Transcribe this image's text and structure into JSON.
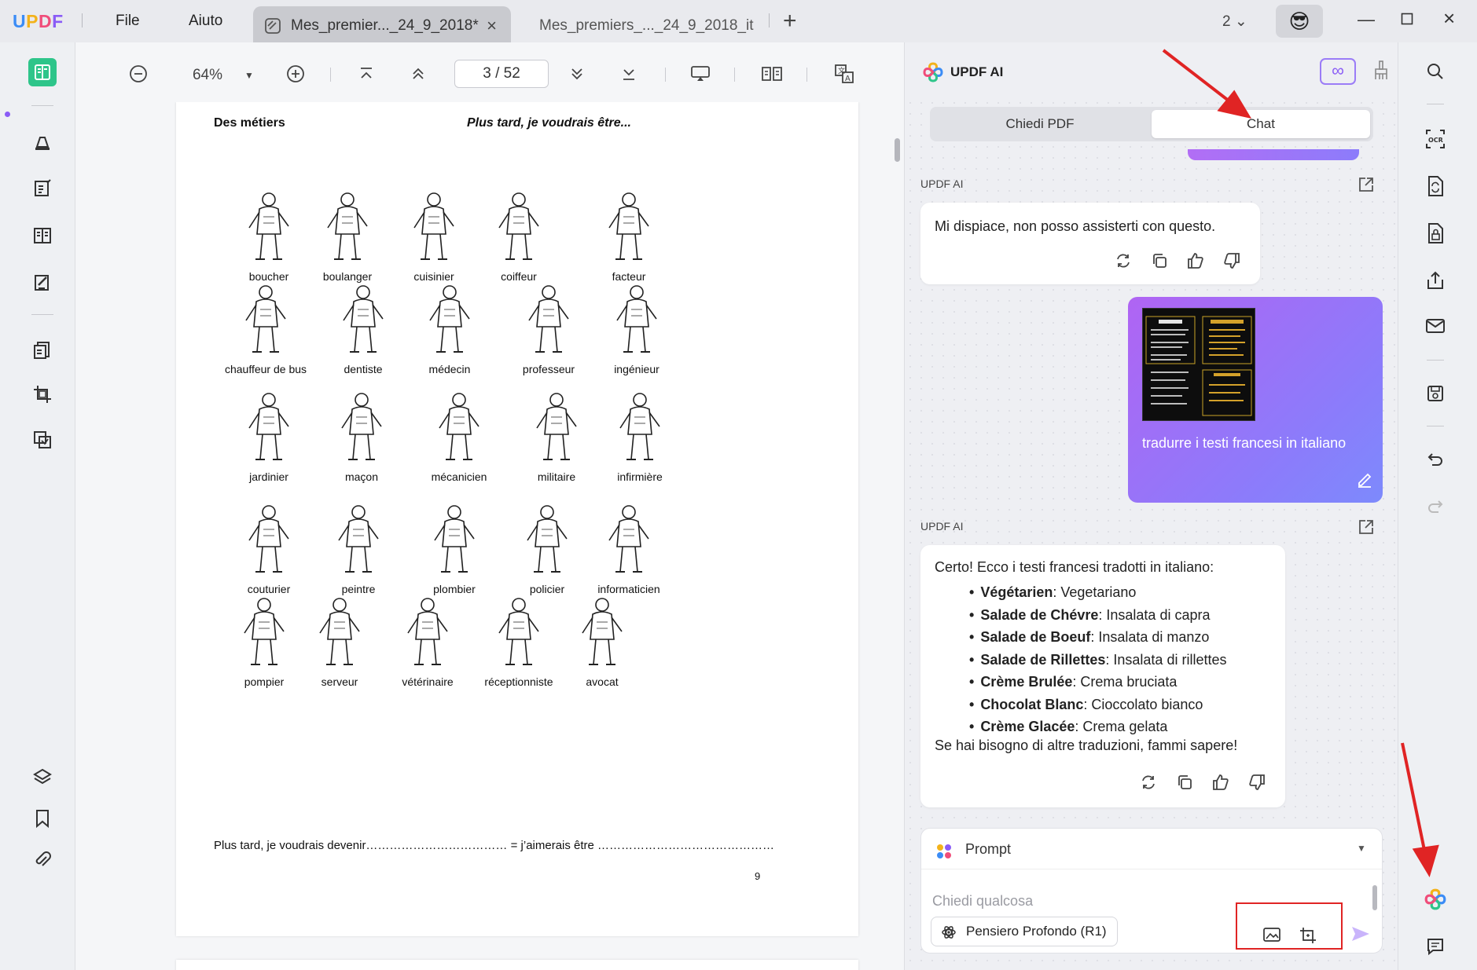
{
  "app": {
    "logo": "UPDF",
    "menu": [
      "File",
      "Aiuto"
    ],
    "tabs": [
      {
        "label": "Mes_premier..._24_9_2018*",
        "active": true
      },
      {
        "label": "Mes_premiers_..._24_9_2018_it",
        "active": false
      }
    ],
    "page_count_badge": "2",
    "avatar_emoji": "😎"
  },
  "toolbar": {
    "zoom": "64%",
    "page_current": "3",
    "page_total": "52",
    "page_display": "3  /  52"
  },
  "document": {
    "heading_left": "Des métiers",
    "heading_right": "Plus tard, je voudrais être...",
    "jobs": [
      [
        "boucher",
        "boulanger",
        "cuisinier",
        "coiffeur",
        "facteur"
      ],
      [
        "chauffeur de bus",
        "dentiste",
        "médecin",
        "professeur",
        "ingénieur"
      ],
      [
        "jardinier",
        "maçon",
        "mécanicien",
        "militaire",
        "infirmière"
      ],
      [
        "couturier",
        "peintre",
        "plombier",
        "policier",
        "informaticien"
      ],
      [
        "pompier",
        "serveur",
        "vétérinaire",
        "réceptionniste",
        "avocat"
      ]
    ],
    "footer_line": "Plus tard, je voudrais devenir……………………………… = j’aimerais être ………………………………………",
    "page_number": "9"
  },
  "ai_panel": {
    "title": "UPDF AI",
    "infinity": "∞",
    "tabs": [
      "Chiedi PDF",
      "Chat"
    ],
    "active_tab": "Chat",
    "sender_label": "UPDF AI",
    "message_1": "Mi dispiace, non posso assisterti con questo.",
    "user_message": "tradurre i testi francesi in italiano",
    "message_2": {
      "intro": "Certo! Ecco i testi francesi tradotti in italiano:",
      "items": [
        {
          "fr": "Végétarien",
          "it": ": Vegetariano"
        },
        {
          "fr": "Salade de Chévre",
          "it": ": Insalata di capra"
        },
        {
          "fr": "Salade de Boeuf",
          "it": ": Insalata di manzo"
        },
        {
          "fr": "Salade de Rillettes",
          "it": ": Insalata di rillettes"
        },
        {
          "fr": "Crème Brulée",
          "it": ": Crema bruciata"
        },
        {
          "fr": "Chocolat Blanc",
          "it": ": Cioccolato bianco"
        },
        {
          "fr": "Crème Glacée",
          "it": ": Crema gelata"
        }
      ],
      "outro": "Se hai bisogno di altre traduzioni, fammi sapere!"
    },
    "prompt_label": "Prompt",
    "input_placeholder": "Chiedi qualcosa",
    "think_button": "Pensiero Profondo (R1)"
  },
  "colors": {
    "accent_purple": "#8a5cf6",
    "active_green": "#2ec58a",
    "annotation_red": "#e02424"
  }
}
